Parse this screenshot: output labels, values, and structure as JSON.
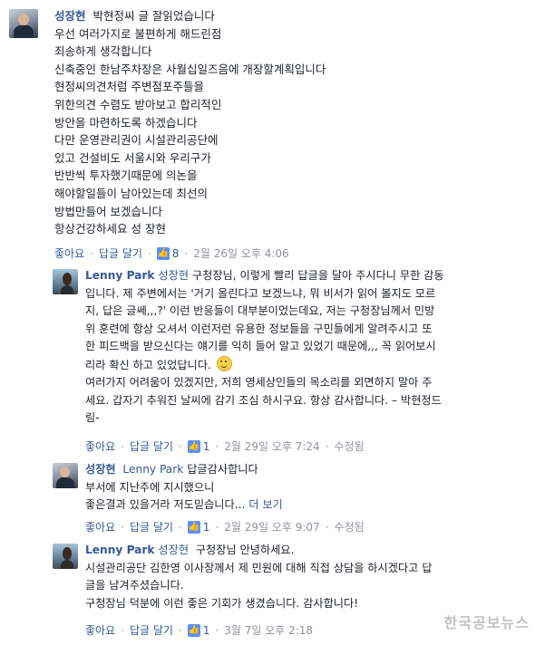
{
  "comments": [
    {
      "author": "성장현",
      "lines": [
        "박현정씨 글 잘읽었습니다",
        "우선 여러가지로 불편하게 해드린점",
        "죄송하게 생각합니다",
        "신축중인 한남주차장은 사월십일즈음에 개장할계획입니다",
        "현정씨의견처럼 주변점포주들을",
        "위한의견 수렴도 받아보고 합리적인",
        "방안을 마련하도록 하겠습니다",
        "다만 운영관리권이 시설관리공단에",
        "있고 건설비도 서울시와 우리구가",
        "반반씩 투자했기때문에 의논을",
        "해야할일들이 남아있는데 최선의",
        "방법만들어 보겠습니다",
        "항상건강하세요 성 장현"
      ],
      "like_label": "좋아요",
      "reply_label": "답글 달기",
      "like_count": "8",
      "timestamp": "2월 26일 오후 4:06"
    },
    {
      "author": "Lenny Park",
      "tag": "성장현",
      "lines": [
        "구청장님, 이렇게 빨리 답글을 달아 주시다니 무한 감동",
        "입니다. 제 주변에서는 '거기 올린다고 보겠느냐, 뭐 비서가 읽어 볼지도 모르",
        "지, 답은 글쎄,,,?' 이런 반응들이 대부분이었는데요, 저는 구청장님께서 민방",
        "위 훈련에 항상 오셔서 이런저런 유용한 정보들을 구민들에게 알려주시고 또",
        "한 피드백을 받으신다는 얘기를 익히 들어 알고 있었기 때문에,,, 꼭 읽어보시",
        "리라 확신 하고 있었답니다.",
        "여러가지 어려움이 있겠지만, 저희 영세상인들의 목소리를 외면하지 말아 주",
        "세요. 갑자기 추워진 날씨에 감기 조심 하시구요. 항상 감사합니다. – 박현정드",
        "림-"
      ],
      "like_label": "좋아요",
      "reply_label": "답글 달기",
      "like_count": "1",
      "timestamp": "2월 29일 오후 7:24",
      "edited": "수정됨"
    },
    {
      "author": "성장현",
      "tag": "Lenny Park",
      "lines": [
        "답글감사합니다",
        "부서에 지난주에 지시했으니",
        "좋은결과 있을거라 저도믿습니다..."
      ],
      "see_more": "더 보기",
      "like_label": "좋아요",
      "reply_label": "답글 달기",
      "like_count": "1",
      "timestamp": "2월 29일 오후 9:07",
      "edited": "수정됨"
    },
    {
      "author": "Lenny Park",
      "tag": "성장현",
      "lines": [
        "구청장님 안녕하세요.",
        "시설관리공단 김한영 이사장께서 제 민원에 대해 직접 상담을 하시겠다고 답",
        "글을 남겨주셨습니다.",
        "구청장님 덕분에 이런 좋은 기회가 생겼습니다. 감사합니다!"
      ],
      "like_label": "좋아요",
      "reply_label": "답글 달기",
      "like_count": "1",
      "timestamp": "3월 7일 오후 2:18"
    }
  ],
  "watermark": "한국공보뉴스",
  "icons": {
    "like": "thumbs-up-icon",
    "smile": "smile-emoji-icon"
  },
  "colors": {
    "link": "#365899",
    "meta": "#90949c",
    "like_badge": "#5890ff"
  }
}
